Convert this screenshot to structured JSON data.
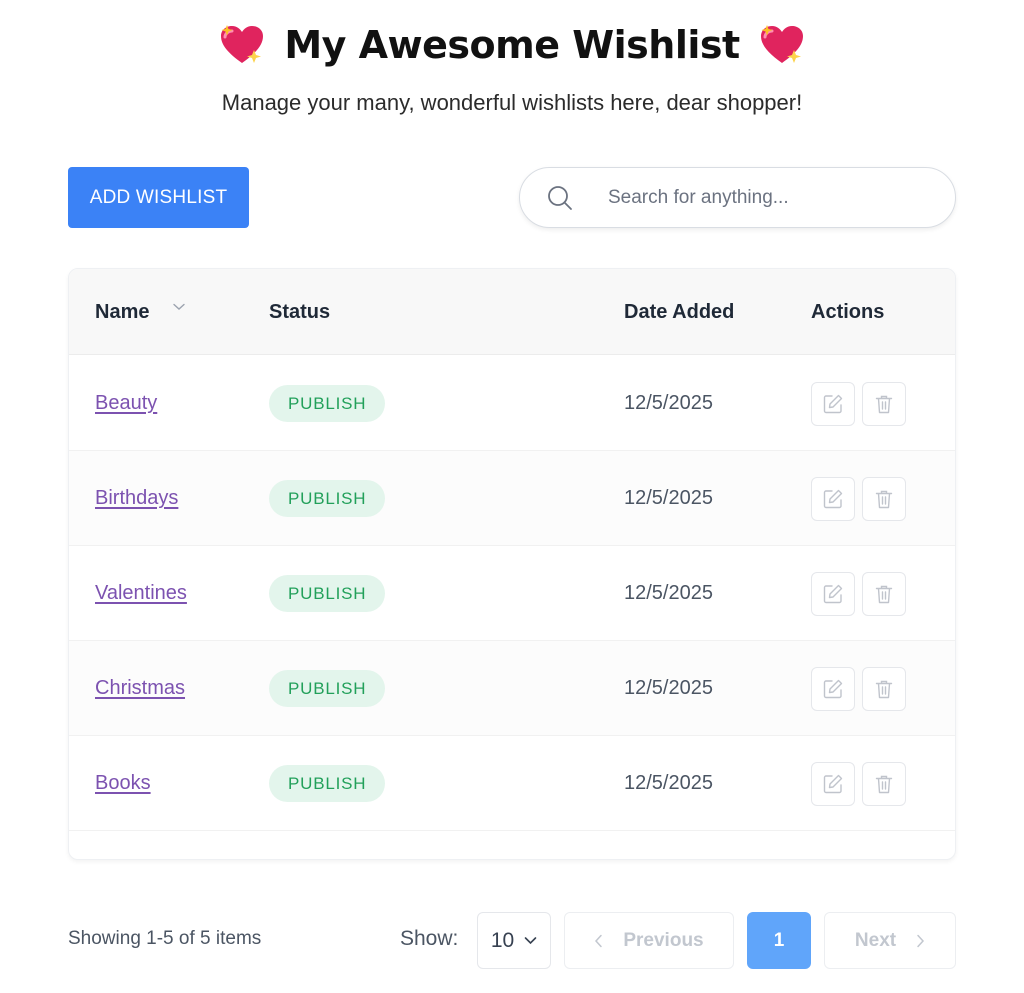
{
  "header": {
    "title": "My Awesome Wishlist",
    "subtitle": "Manage your many, wonderful wishlists here, dear shopper!",
    "emoji_icon": "sparkling-heart-icon"
  },
  "toolbar": {
    "add_label": "ADD WISHLIST",
    "search_placeholder": "Search for anything...",
    "search_value": ""
  },
  "table": {
    "columns": {
      "name": "Name",
      "status": "Status",
      "date": "Date Added",
      "actions": "Actions"
    },
    "rows": [
      {
        "name": "Beauty",
        "status": "PUBLISH",
        "date": "12/5/2025"
      },
      {
        "name": "Birthdays",
        "status": "PUBLISH",
        "date": "12/5/2025"
      },
      {
        "name": "Valentines",
        "status": "PUBLISH",
        "date": "12/5/2025"
      },
      {
        "name": "Christmas",
        "status": "PUBLISH",
        "date": "12/5/2025"
      },
      {
        "name": "Books",
        "status": "PUBLISH",
        "date": "12/5/2025"
      }
    ]
  },
  "footer": {
    "showing": "Showing 1-5 of 5 items",
    "show_label": "Show:",
    "per_page": "10",
    "prev_label": "Previous",
    "next_label": "Next",
    "current_page": "1"
  },
  "colors": {
    "primary": "#3b82f6",
    "page_active": "#60a5fa",
    "link": "#7c52b0",
    "badge_bg": "#e3f5ec",
    "badge_text": "#22a05a"
  }
}
